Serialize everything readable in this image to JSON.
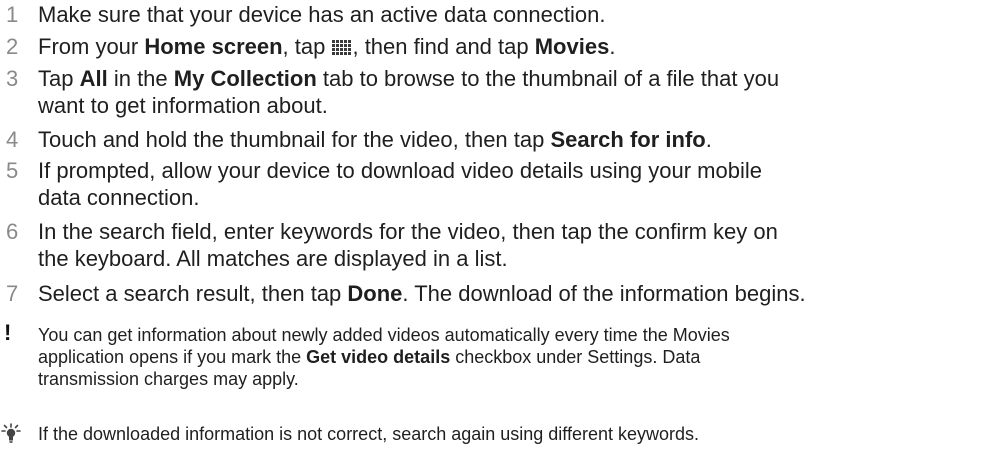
{
  "steps": [
    {
      "number": "1",
      "parts": [
        "Make sure that your device has an active data connection."
      ]
    },
    {
      "number": "2",
      "parts": [
        "From your ",
        "Home screen",
        ", tap ",
        ", then find and tap ",
        "Movies",
        "."
      ]
    },
    {
      "number": "3",
      "line1": [
        "Tap ",
        "All",
        " in the ",
        "My Collection",
        " tab to browse to the thumbnail of a file that you"
      ],
      "line2": "want to get information about."
    },
    {
      "number": "4",
      "parts": [
        "Touch and hold the thumbnail for the video, then tap ",
        "Search for info",
        "."
      ]
    },
    {
      "number": "5",
      "line1": "If prompted, allow your device to download video details using your mobile",
      "line2": "data connection."
    },
    {
      "number": "6",
      "line1": "In the search field, enter keywords for the video, then tap the confirm key on",
      "line2": "the keyboard. All matches are displayed in a list."
    },
    {
      "number": "7",
      "parts": [
        "Select a search result, then tap ",
        "Done",
        ". The download of the information begins."
      ]
    }
  ],
  "note": {
    "icon": "exclamation-icon",
    "line1": "You can get information about newly added videos automatically every time the Movies",
    "line2": [
      "application opens if you mark the ",
      "Get video details",
      " checkbox under Settings. Data"
    ],
    "line3": "transmission charges may apply."
  },
  "tip": {
    "icon": "lightbulb-icon",
    "text": "If the downloaded information is not correct, search again using different keywords."
  },
  "inline_icon": "apps-grid-icon"
}
